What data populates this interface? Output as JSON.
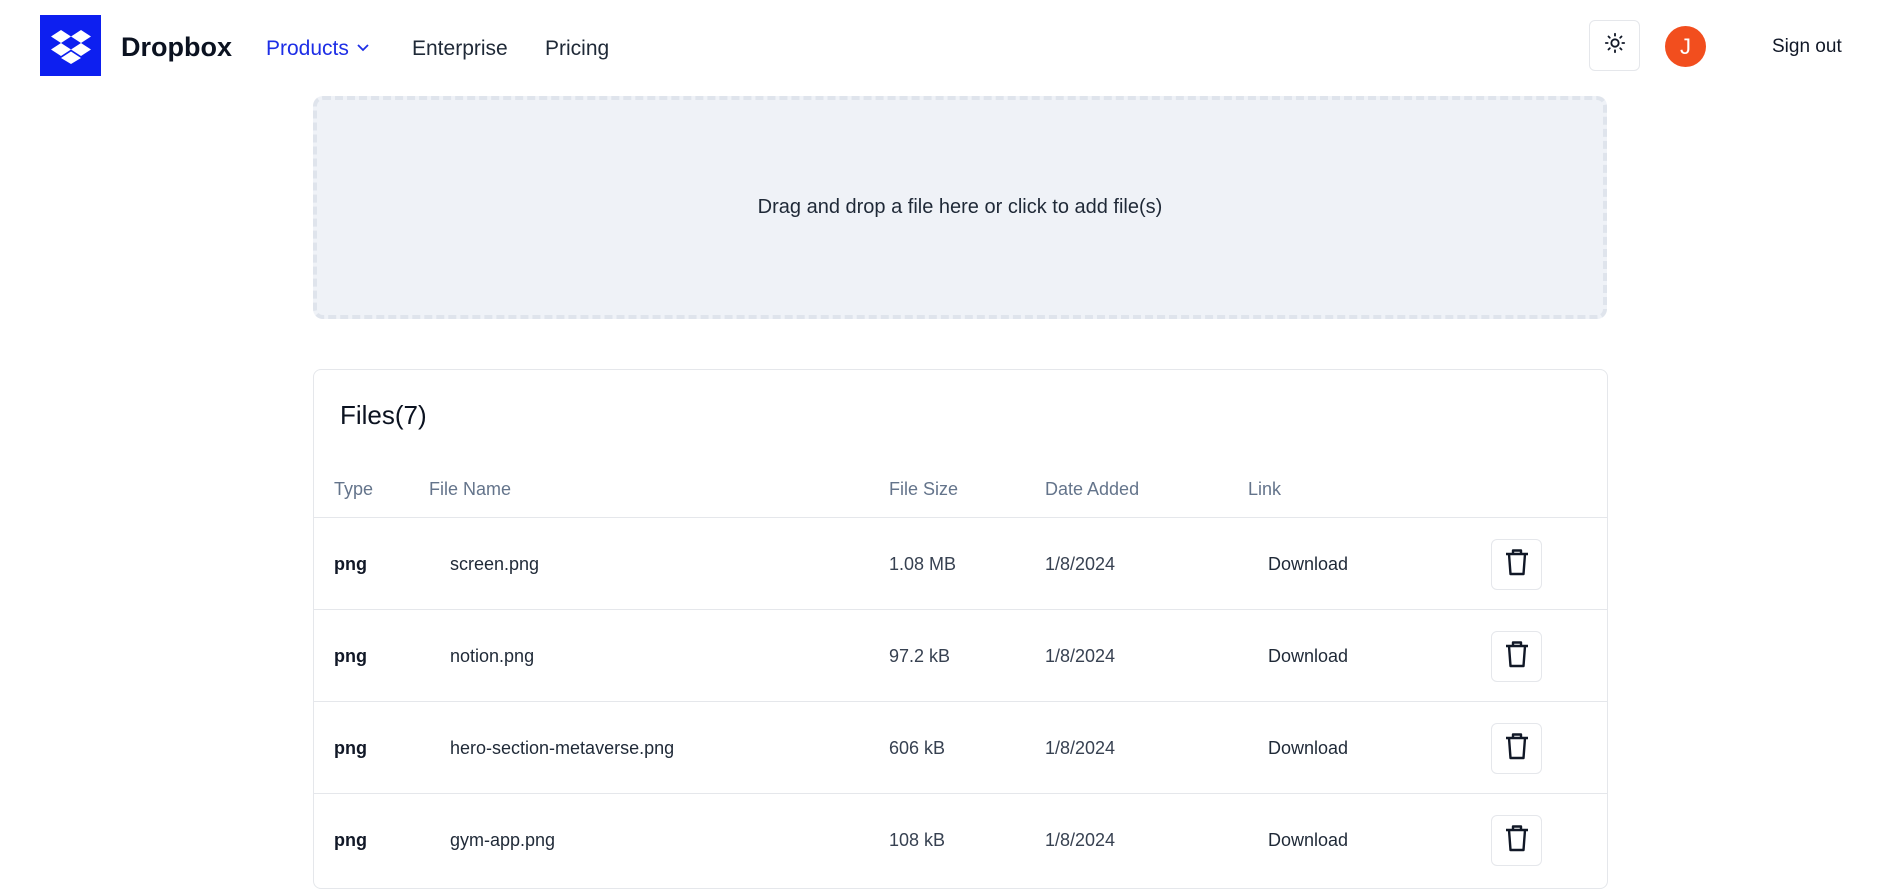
{
  "header": {
    "brand": "Dropbox",
    "nav": [
      {
        "label": "Products"
      },
      {
        "label": "Enterprise"
      },
      {
        "label": "Pricing"
      }
    ],
    "avatar_initial": "J",
    "sign_out": "Sign out"
  },
  "dropzone": {
    "text": "Drag and drop a file here or click to add file(s)"
  },
  "files": {
    "title": "Files(7)",
    "columns": [
      "Type",
      "File Name",
      "File Size",
      "Date Added",
      "Link"
    ],
    "rows": [
      {
        "type": "png",
        "name": "screen.png",
        "size": "1.08 MB",
        "date": "1/8/2024",
        "link": "Download"
      },
      {
        "type": "png",
        "name": "notion.png",
        "size": "97.2 kB",
        "date": "1/8/2024",
        "link": "Download"
      },
      {
        "type": "png",
        "name": "hero-section-metaverse.png",
        "size": "606 kB",
        "date": "1/8/2024",
        "link": "Download"
      },
      {
        "type": "png",
        "name": "gym-app.png",
        "size": "108 kB",
        "date": "1/8/2024",
        "link": "Download"
      }
    ]
  },
  "colors": {
    "brand": "#0d1ff0",
    "nav_active": "#1d2ee6",
    "avatar": "#f24e1e",
    "dropzone_bg": "#eff2f7"
  },
  "icons": {
    "logo": "dropbox-logo-icon",
    "theme": "sun-icon",
    "nav_dropdown": "chevron-down-icon",
    "delete": "trash-icon"
  }
}
